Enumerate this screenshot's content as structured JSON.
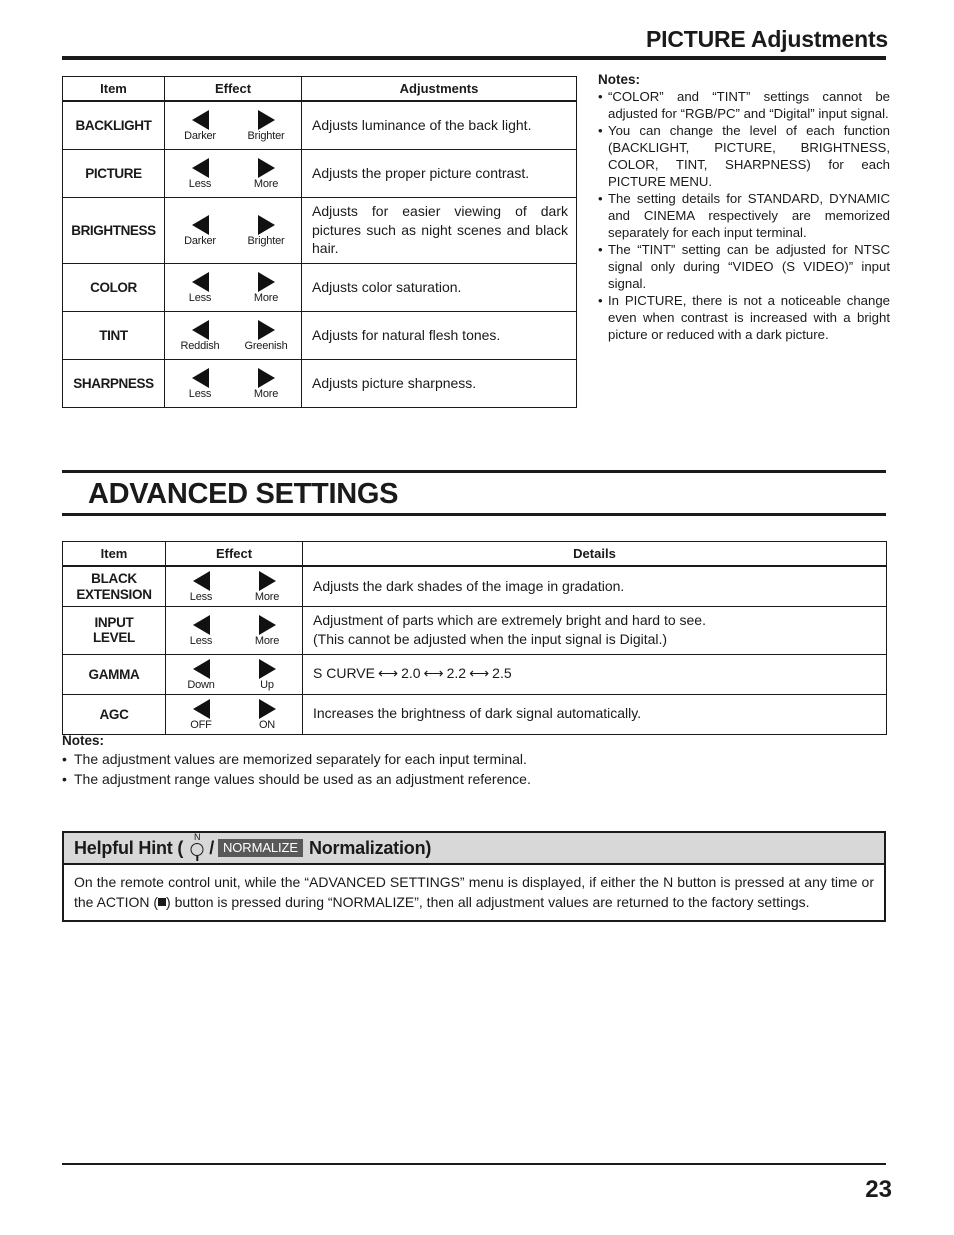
{
  "header": {
    "title": "PICTURE Adjustments"
  },
  "picture_table": {
    "columns": [
      "Item",
      "Effect",
      "Adjustments"
    ],
    "rows": [
      {
        "item": "BACKLIGHT",
        "left_label": "Darker",
        "right_label": "Brighter",
        "description": "Adjusts luminance of the back light."
      },
      {
        "item": "PICTURE",
        "left_label": "Less",
        "right_label": "More",
        "description": "Adjusts the proper picture contrast."
      },
      {
        "item": "BRIGHTNESS",
        "left_label": "Darker",
        "right_label": "Brighter",
        "description": "Adjusts for easier viewing of dark pictures such as night scenes and black hair."
      },
      {
        "item": "COLOR",
        "left_label": "Less",
        "right_label": "More",
        "description": "Adjusts color saturation."
      },
      {
        "item": "TINT",
        "left_label": "Reddish",
        "right_label": "Greenish",
        "description": "Adjusts for natural flesh tones."
      },
      {
        "item": "SHARPNESS",
        "left_label": "Less",
        "right_label": "More",
        "description": "Adjusts picture sharpness."
      }
    ]
  },
  "notes_right": {
    "heading": "Notes:",
    "items": [
      "“COLOR” and “TINT” settings cannot be adjusted for “RGB/PC” and “Digital” input signal.",
      "You can change the level of each function (BACKLIGHT, PICTURE, BRIGHTNESS, COLOR, TINT, SHARPNESS) for each PICTURE MENU.",
      "The setting details for STANDARD, DYNAMIC and CINEMA respectively are memorized separately for each input terminal.",
      "The “TINT” setting can be adjusted for NTSC signal only during “VIDEO (S VIDEO)” input signal.",
      "In PICTURE, there is not a noticeable change even when contrast is increased with a bright picture or reduced with a dark picture."
    ]
  },
  "advanced": {
    "title": "ADVANCED SETTINGS",
    "columns": [
      "Item",
      "Effect",
      "Details"
    ],
    "rows": [
      {
        "item": "BLACK EXTENSION",
        "item_line1": "BLACK",
        "item_line2": "EXTENSION",
        "left_label": "Less",
        "right_label": "More",
        "details_line1": "Adjusts the dark shades of the image in gradation.",
        "details_line2": ""
      },
      {
        "item": "INPUT LEVEL",
        "item_line1": "INPUT",
        "item_line2": "LEVEL",
        "left_label": "Less",
        "right_label": "More",
        "details_line1": "Adjustment of parts which are extremely bright and hard to see.",
        "details_line2": "(This cannot be adjusted when the input signal is Digital.)"
      },
      {
        "item": "GAMMA",
        "item_line1": "GAMMA",
        "item_line2": "",
        "left_label": "Down",
        "right_label": "Up",
        "details_line1": "",
        "details_line2": "",
        "gamma_steps": [
          "S CURVE",
          "2.0",
          "2.2",
          "2.5"
        ]
      },
      {
        "item": "AGC",
        "item_line1": "AGC",
        "item_line2": "",
        "left_label": "OFF",
        "right_label": "ON",
        "details_line1": "Increases the brightness of dark signal automatically.",
        "details_line2": ""
      }
    ]
  },
  "notes_bottom": {
    "heading": "Notes:",
    "items": [
      "The adjustment values are memorized separately for each input terminal.",
      "The adjustment range values should be used as an adjustment reference."
    ]
  },
  "hint": {
    "title_prefix": "Helpful Hint (",
    "n_letter": "N",
    "separator": "/",
    "badge": "NORMALIZE",
    "title_suffix": "Normalization)",
    "body_part1": "On the remote control unit, while the “ADVANCED SETTINGS” menu is displayed, if either the N button is pressed at any time or the ACTION (",
    "body_part2": ") button is pressed during “NORMALIZE”, then all adjustment values are returned to the factory settings."
  },
  "footer": {
    "page_number": "23"
  },
  "colors": {
    "ink": "#1a1a1a",
    "hint_header_bg": "#d8d8d8",
    "badge_bg": "#595959",
    "badge_fg": "#ffffff"
  }
}
